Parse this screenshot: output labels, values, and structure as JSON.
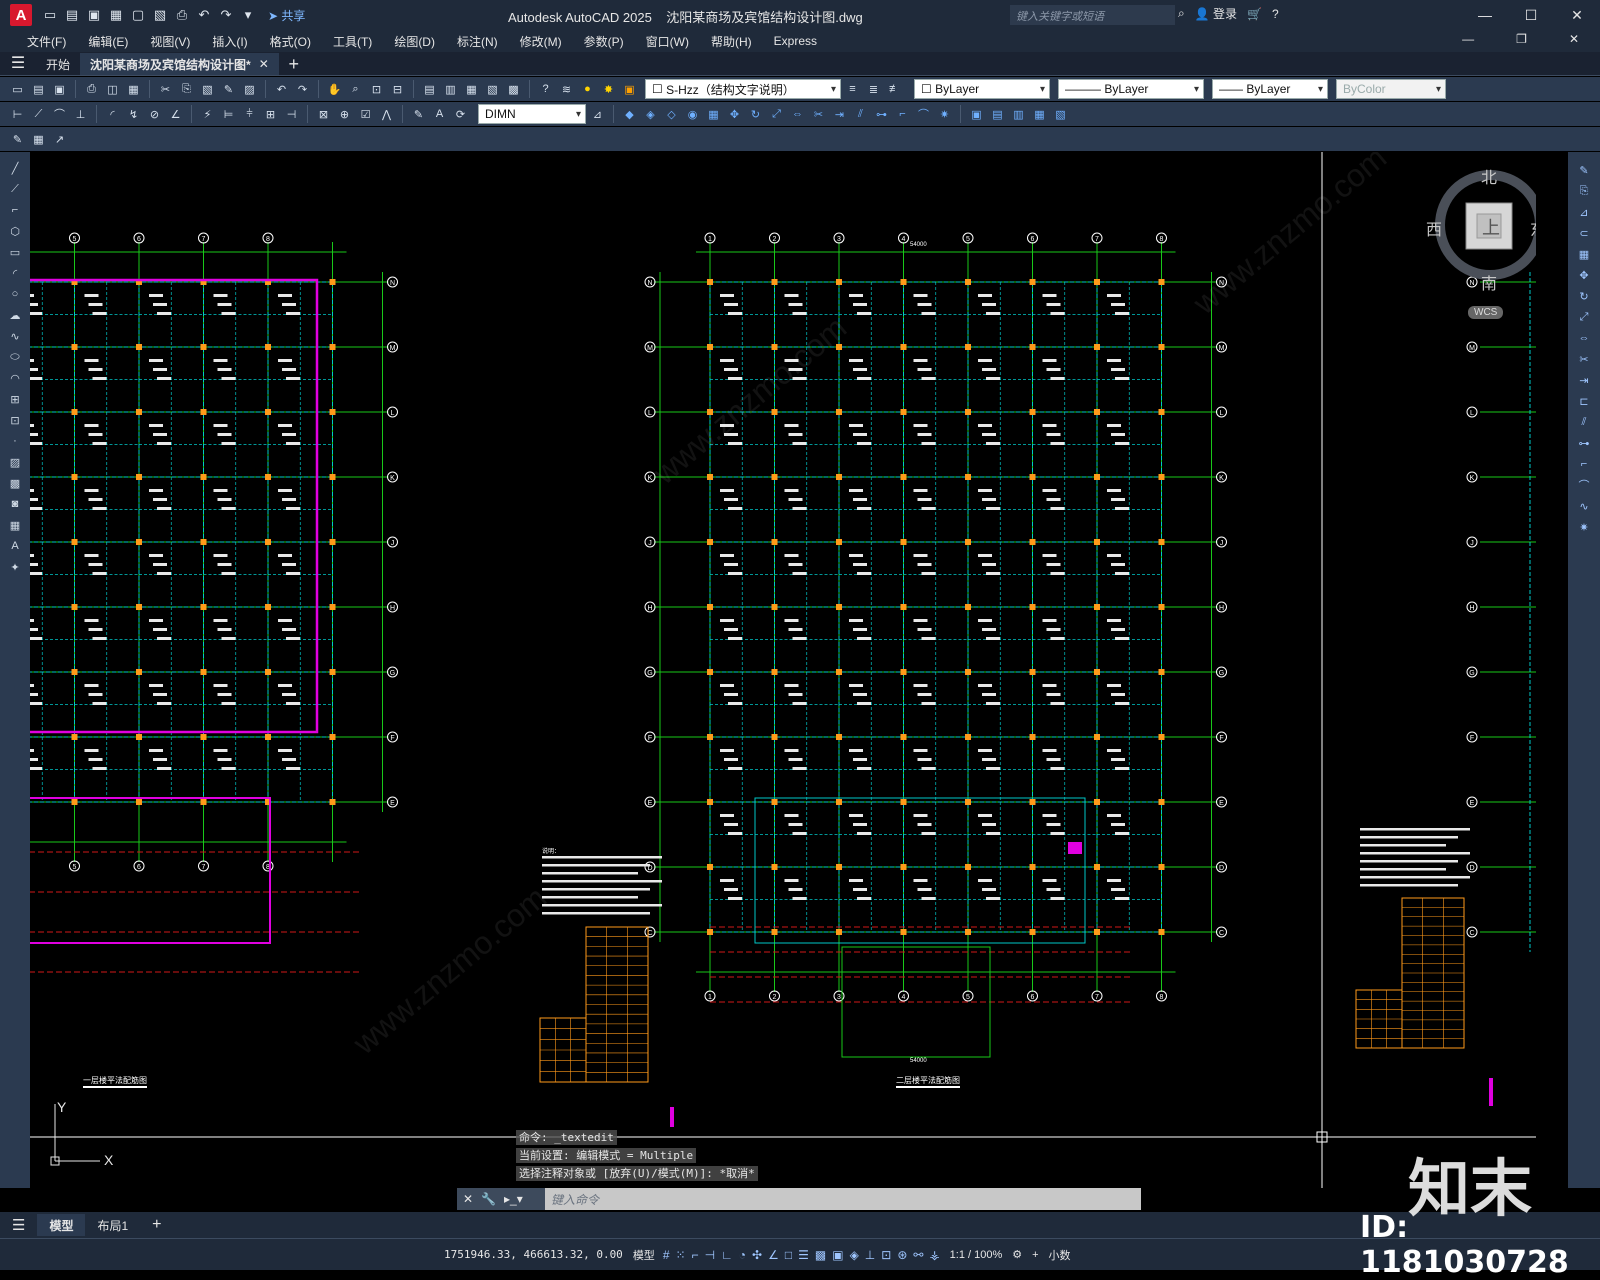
{
  "window": {
    "app_title": "Autodesk AutoCAD 2025",
    "file_title": "沈阳某商场及宾馆结构设计图.dwg",
    "share_label": "共享",
    "search_placeholder": "键入关键字或短语",
    "login_label": "登录"
  },
  "menu": {
    "items": [
      "文件(F)",
      "编辑(E)",
      "视图(V)",
      "插入(I)",
      "格式(O)",
      "工具(T)",
      "绘图(D)",
      "标注(N)",
      "修改(M)",
      "参数(P)",
      "窗口(W)",
      "帮助(H)",
      "Express"
    ]
  },
  "tabs": {
    "start": "开始",
    "document": "沈阳某商场及宾馆结构设计图*"
  },
  "properties": {
    "layer": "S-Hzz（结构文字说明）",
    "color": "ByLayer",
    "linetype": "ByLayer",
    "lineweight": "ByLayer",
    "plotstyle": "ByColor",
    "dimstyle": "DIMN"
  },
  "viewcube": {
    "north": "北",
    "south": "南",
    "east": "东",
    "west": "西",
    "face": "上",
    "ucs": "WCS"
  },
  "drawings": {
    "left_title": "一层楼平法配筋图",
    "center_title": "二层楼平法配筋图",
    "center_top_dim": "54000",
    "center_bottom_dim": "54000",
    "center_top_segments": [
      "4200",
      "8400",
      "8400",
      "8400",
      "8400",
      "8400",
      "8400"
    ],
    "axis_cols": [
      "1",
      "2",
      "3",
      "4",
      "5",
      "6",
      "7",
      "8"
    ],
    "axis_rows": [
      "N",
      "M",
      "L",
      "K",
      "J",
      "H",
      "G",
      "F",
      "E",
      "D",
      "C",
      "B",
      "A"
    ],
    "notes_heading": "说明："
  },
  "command": {
    "history": [
      "命令: _textedit",
      "当前设置: 编辑模式 = Multiple",
      "选择注释对象或 [放弃(U)/模式(M)]: *取消*"
    ],
    "placeholder": "键入命令"
  },
  "layouts": {
    "model": "模型",
    "layout1": "布局1"
  },
  "status": {
    "coords": "1751946.33, 466613.32, 0.00",
    "space": "模型",
    "scale": "1:1 / 100%",
    "units": "小数"
  },
  "watermark": {
    "logo": "知末",
    "id": "ID: 1181030728",
    "site": "www.znzmo.com"
  },
  "colors": {
    "grid_line": "#19c819",
    "column": "#ff9a1a",
    "beam": "#00c8c8",
    "boundary": "#e000e0",
    "axis_red": "#d01818"
  }
}
